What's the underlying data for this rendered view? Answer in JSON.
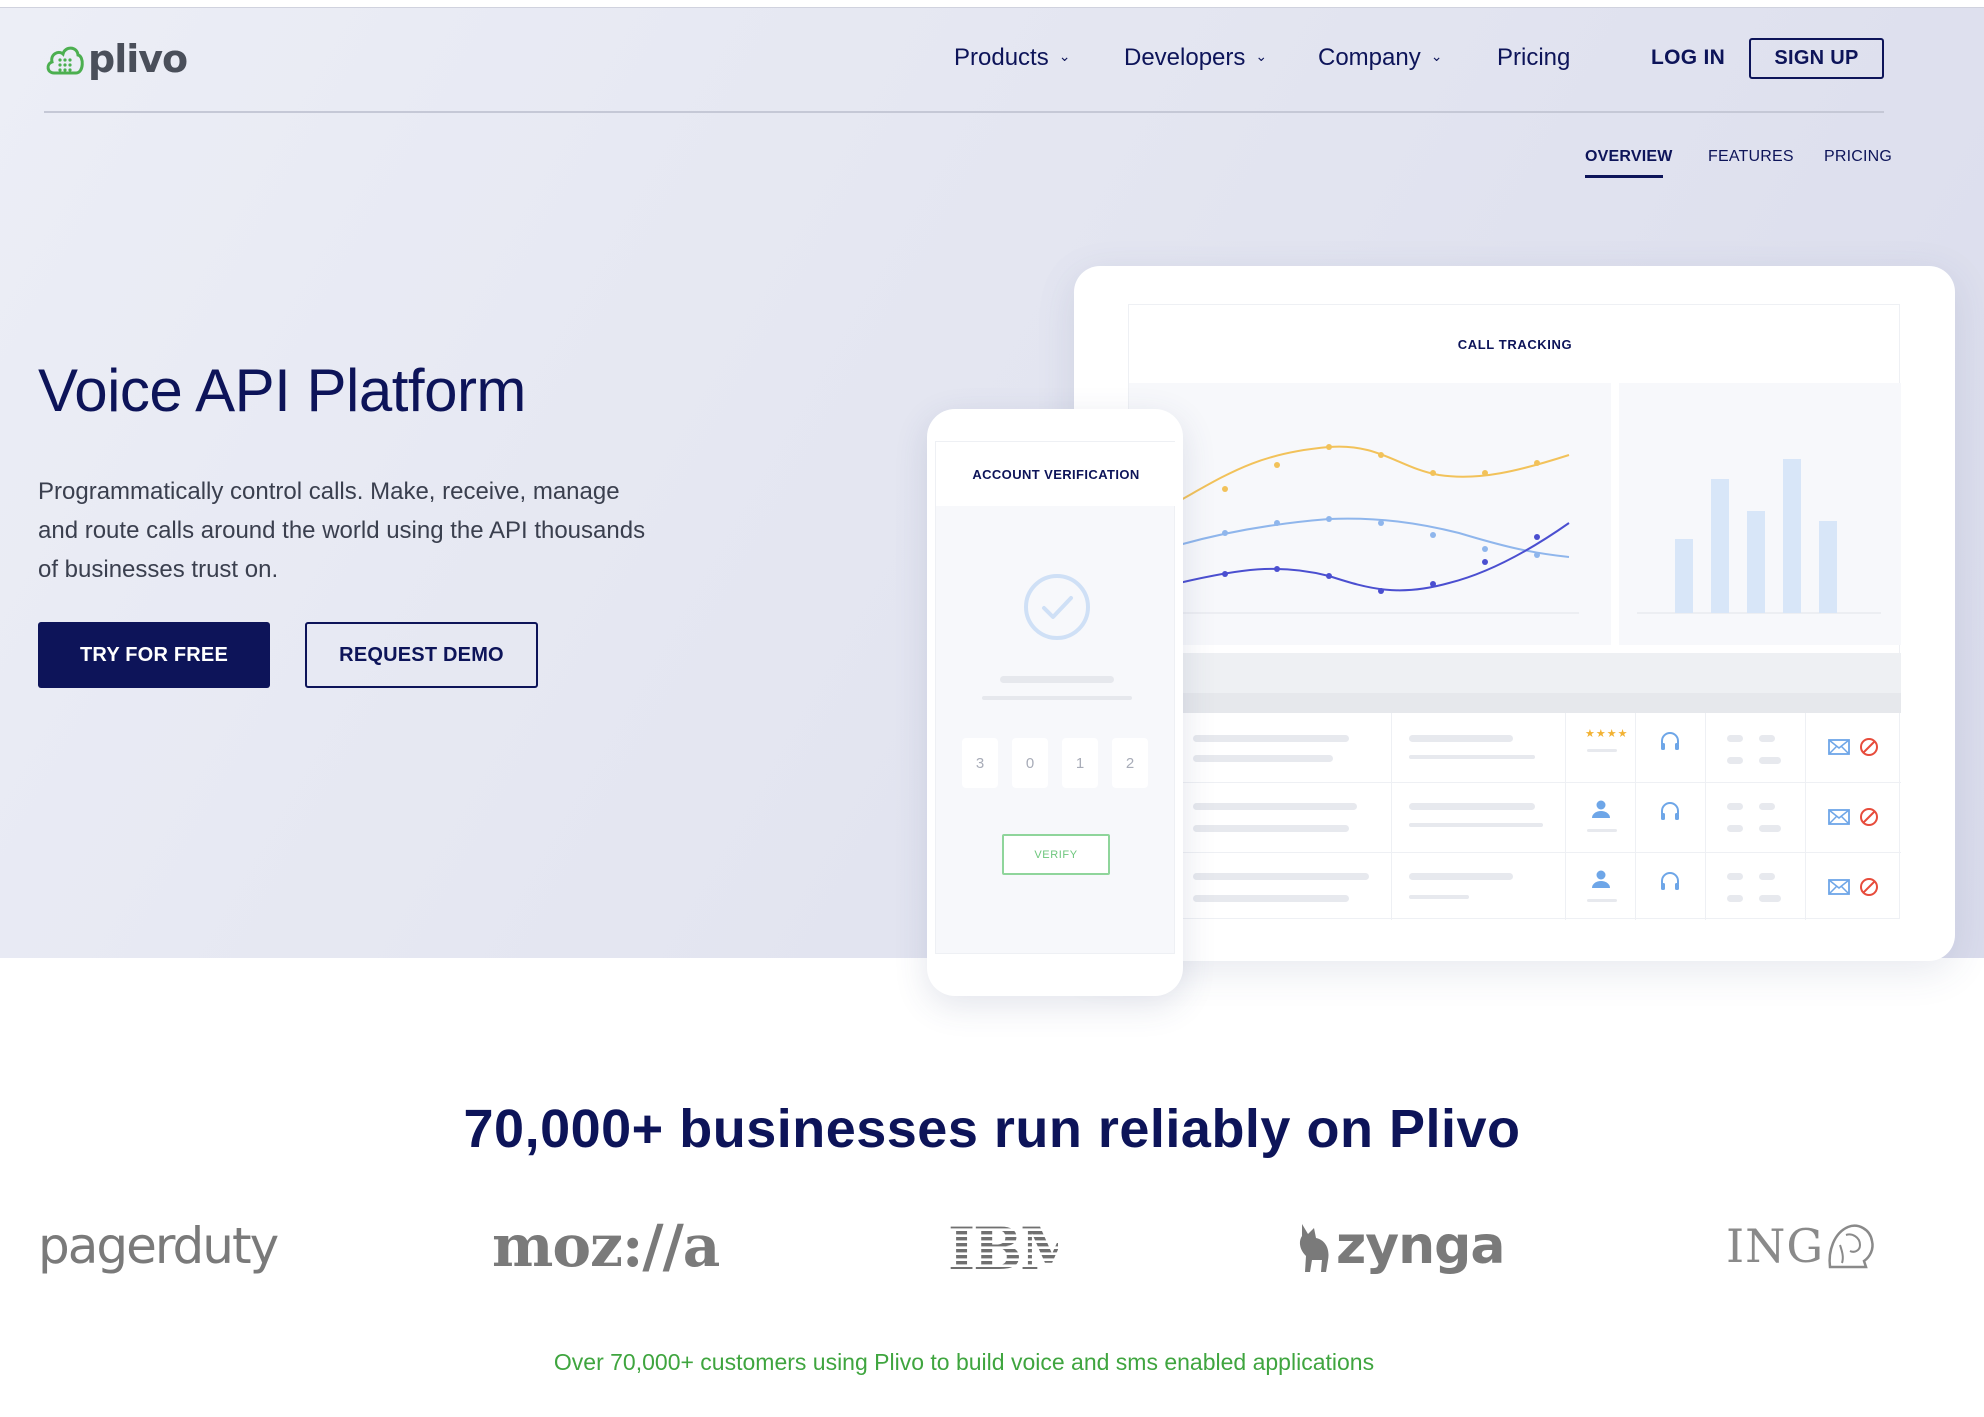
{
  "brand": {
    "name": "plivo",
    "logo_color": "#4caf50"
  },
  "nav": {
    "products": "Products",
    "developers": "Developers",
    "company": "Company",
    "pricing": "Pricing",
    "login": "LOG IN",
    "signup": "SIGN UP"
  },
  "subnav": {
    "overview": "OVERVIEW",
    "features": "FEATURES",
    "pricing": "PRICING"
  },
  "hero": {
    "title": "Voice API Platform",
    "description": "Programmatically control calls. Make, receive, manage and route calls around the world using the API thousands of businesses trust on.",
    "primary_cta": "TRY FOR FREE",
    "secondary_cta": "REQUEST DEMO"
  },
  "dashboard": {
    "title": "CALL TRACKING",
    "rating_stars": "★★★★"
  },
  "phone": {
    "title": "ACCOUNT VERIFICATION",
    "digits": [
      "3",
      "0",
      "1",
      "2"
    ],
    "verify": "VERIFY"
  },
  "customers": {
    "headline": "70,000+ businesses run reliably on Plivo",
    "logos": {
      "pagerduty": "pagerduty",
      "mozilla": "moz://a",
      "ibm": "IBM",
      "zynga": "zynga",
      "ing": "ING"
    },
    "tagline": "Over 70,000+ customers using Plivo to build voice and sms enabled applications"
  },
  "colors": {
    "navy": "#0d1459",
    "tagline_green": "#3fa53f",
    "chart_yellow": "#f2c25a",
    "chart_light_blue": "#8fb6ec",
    "chart_indigo": "#4b4fd0",
    "bars": "#d8e6f8"
  }
}
